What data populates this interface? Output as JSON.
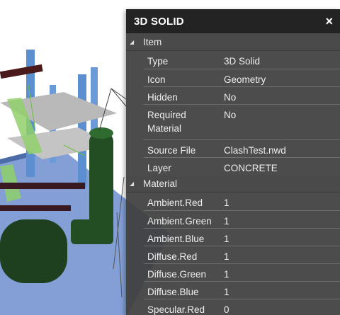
{
  "panel": {
    "title": "3D SOLID",
    "close_glyph": "×",
    "sections": [
      {
        "name": "Item",
        "rows": [
          {
            "label": "Type",
            "value": "3D Solid"
          },
          {
            "label": "Icon",
            "value": "Geometry"
          },
          {
            "label": "Hidden",
            "value": "No"
          },
          {
            "label": "Required Material",
            "value": "No"
          },
          {
            "label": "Source File",
            "value": "ClashTest.nwd"
          },
          {
            "label": "Layer",
            "value": "CONCRETE"
          }
        ]
      },
      {
        "name": "Material",
        "rows": [
          {
            "label": "Ambient.Red",
            "value": "1"
          },
          {
            "label": "Ambient.Green",
            "value": "1"
          },
          {
            "label": "Ambient.Blue",
            "value": "1"
          },
          {
            "label": "Diffuse.Red",
            "value": "1"
          },
          {
            "label": "Diffuse.Green",
            "value": "1"
          },
          {
            "label": "Diffuse.Blue",
            "value": "1"
          },
          {
            "label": "Specular.Red",
            "value": "0"
          }
        ]
      }
    ]
  },
  "colors": {
    "panel_bg": "#3e3e3e",
    "header_bg": "#232323",
    "floor_blue": "#5a7fc8",
    "column_blue": "#5b8fd0",
    "tank_green": "#234d23"
  }
}
